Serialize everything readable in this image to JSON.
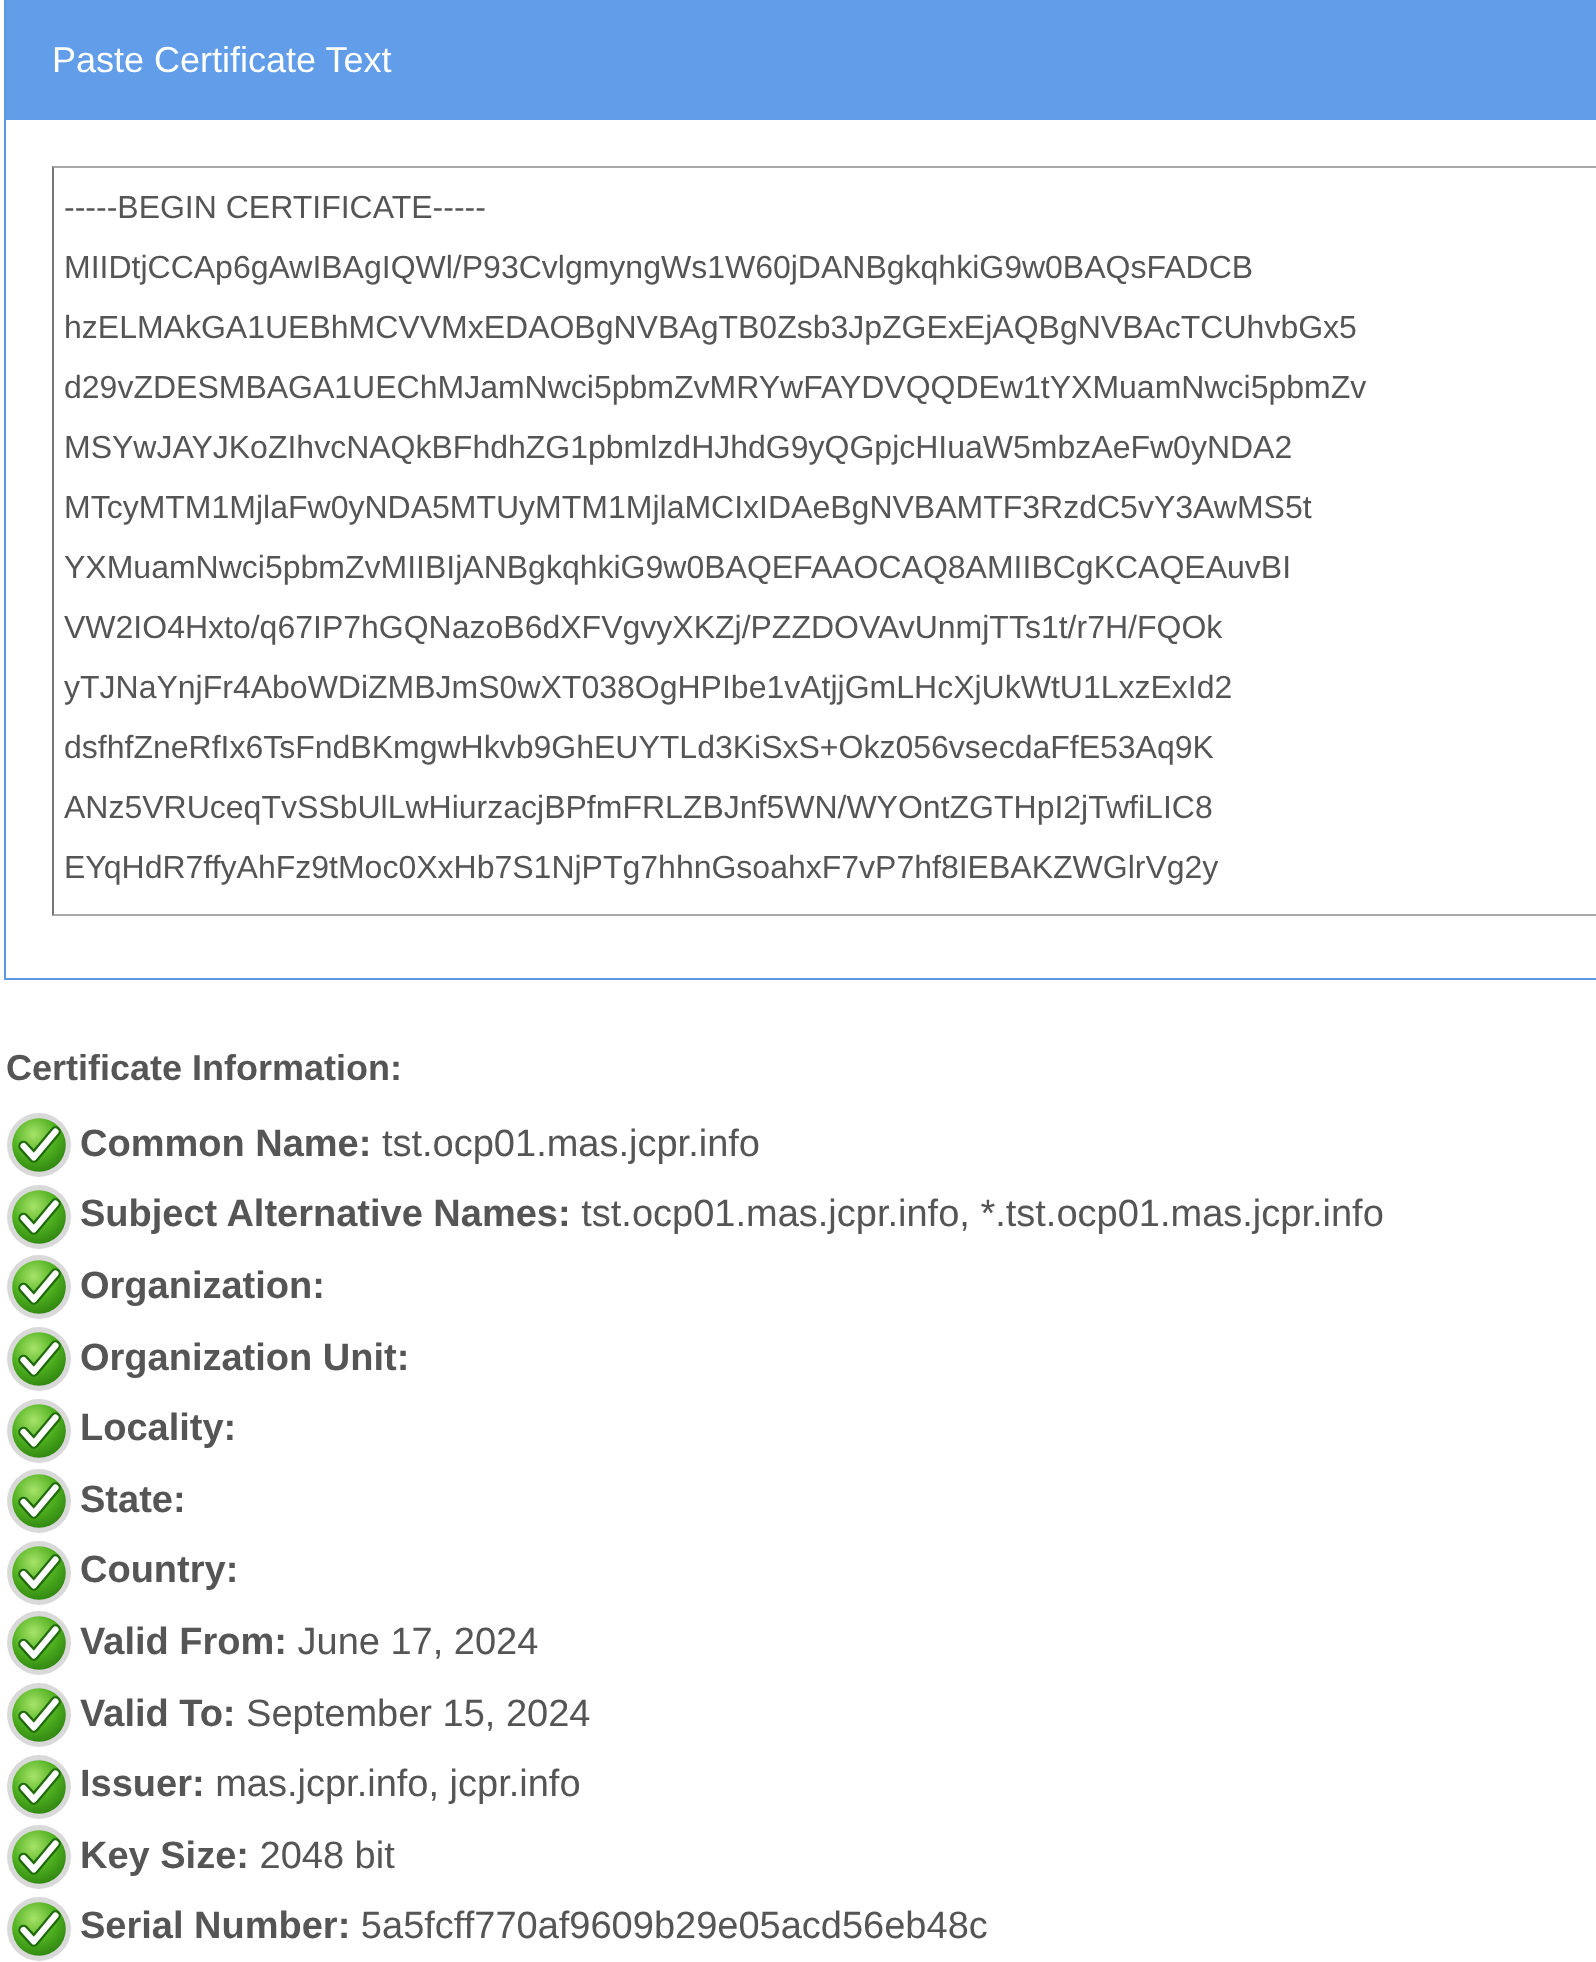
{
  "panel": {
    "title": "Paste Certificate Text",
    "certificate_text": {
      "lines": [
        "-----BEGIN CERTIFICATE-----",
        "MIIDtjCCAp6gAwIBAgIQWl/P93CvlgmyngWs1W60jDANBgkqhkiG9w0BAQsFADCB",
        "hzELMAkGA1UEBhMCVVMxEDAOBgNVBAgTB0Zsb3JpZGExEjAQBgNVBAcTCUhvbGx5",
        "d29vZDESMBAGA1UEChMJamNwci5pbmZvMRYwFAYDVQQDEw1tYXMuamNwci5pbmZv",
        "MSYwJAYJKoZIhvcNAQkBFhdhZG1pbmlzdHJhdG9yQGpjcHIuaW5mbzAeFw0yNDA2",
        "MTcyMTM1MjlaFw0yNDA5MTUyMTM1MjlaMCIxIDAeBgNVBAMTF3RzdC5vY3AwMS5t",
        "YXMuamNwci5pbmZvMIIBIjANBgkqhkiG9w0BAQEFAAOCAQ8AMIIBCgKCAQEAuvBI",
        "VW2IO4Hxto/q67IP7hGQNazoB6dXFVgvyXKZj/PZZDOVAvUnmjTTs1t/r7H/FQOk",
        "yTJNaYnjFr4AboWDiZMBJmS0wXT038OgHPIbe1vAtjjGmLHcXjUkWtU1LxzExId2",
        "dsfhfZneRfIx6TsFndBKmgwHkvb9GhEUYTLd3KiSxS+Okz056vsecdaFfE53Aq9K",
        "ANz5VRUceqTvSSbUlLwHiurzacjBPfmFRLZBJnf5WN/WYOntZGTHpI2jTwfiLIC8",
        "EYqHdR7ffyAhFz9tMoc0XxHb7S1NjPTg7hhnGsoahxF7vP7hf8IEBAKZWGlrVg2y"
      ]
    }
  },
  "certificate_information": {
    "heading": "Certificate Information:",
    "fields": [
      {
        "label": "Common Name:",
        "value": "tst.ocp01.mas.jcpr.info"
      },
      {
        "label": "Subject Alternative Names:",
        "value": "tst.ocp01.mas.jcpr.info, *.tst.ocp01.mas.jcpr.info"
      },
      {
        "label": "Organization:"
      },
      {
        "label": "Organization Unit:"
      },
      {
        "label": "Locality:"
      },
      {
        "label": "State:"
      },
      {
        "label": "Country:"
      },
      {
        "label": "Valid From:",
        "value": "June 17, 2024"
      },
      {
        "label": "Valid To:",
        "value": "September 15, 2024"
      },
      {
        "label": "Issuer:",
        "value": "mas.jcpr.info, jcpr.info"
      },
      {
        "label": "Key Size:",
        "value": "2048 bit"
      },
      {
        "label": "Serial Number:",
        "value": "5a5fcff770af9609b29e05acd56eb48c"
      }
    ]
  }
}
